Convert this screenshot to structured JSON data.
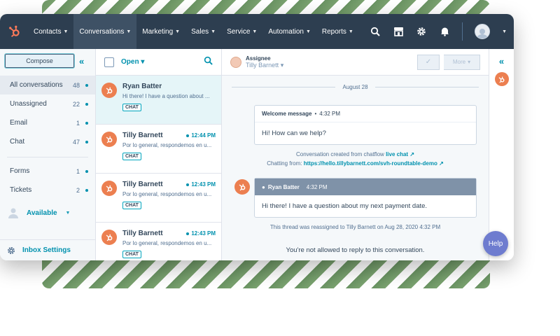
{
  "nav": {
    "items": [
      {
        "label": "Contacts"
      },
      {
        "label": "Conversations"
      },
      {
        "label": "Marketing"
      },
      {
        "label": "Sales"
      },
      {
        "label": "Service"
      },
      {
        "label": "Automation"
      },
      {
        "label": "Reports"
      }
    ],
    "active": "Conversations",
    "brand_color": "#ff7a59",
    "bg_color": "#2d3e50"
  },
  "sidebar": {
    "compose_label": "Compose",
    "items": [
      {
        "label": "All conversations",
        "count": "48"
      },
      {
        "label": "Unassigned",
        "count": "22"
      },
      {
        "label": "Email",
        "count": "1"
      },
      {
        "label": "Chat",
        "count": "47"
      }
    ],
    "items2": [
      {
        "label": "Forms",
        "count": "1"
      },
      {
        "label": "Tickets",
        "count": "2"
      }
    ],
    "status_label": "Available",
    "settings_label": "Inbox Settings"
  },
  "threads": {
    "filter_label": "Open",
    "items": [
      {
        "name": "Ryan Batter",
        "time": "",
        "preview": "Hi there! I have a question about ...",
        "badge": "CHAT"
      },
      {
        "name": "Tilly Barnett",
        "time": "12:44 PM",
        "preview": "Por lo general, respondemos en u...",
        "badge": "CHAT"
      },
      {
        "name": "Tilly Barnett",
        "time": "12:43 PM",
        "preview": "Por lo general, respondemos en u...",
        "badge": "CHAT"
      },
      {
        "name": "Tilly Barnett",
        "time": "12:43 PM",
        "preview": "Por lo general, respondemos en u...",
        "badge": "CHAT"
      }
    ]
  },
  "conversation": {
    "assignee_label": "Assignee",
    "assignee_name": "Tilly Barnett",
    "more_label": "More",
    "date": "August 28",
    "welcome": {
      "title": "Welcome message",
      "time": "4:32 PM",
      "text": "Hi! How can we help?"
    },
    "created_text": "Conversation created from chatflow",
    "created_link": "live chat",
    "chatting_from": "Chatting from:",
    "chatting_url": "https://hello.tillybarnett.com/svh-roundtable-demo",
    "customer_msg": {
      "name": "Ryan Batter",
      "time": "4:32 PM",
      "text": "Hi there! I have a question about my next payment date."
    },
    "reassigned_text": "This thread was reassigned to Tilly Barnett on Aug 28, 2020 4:32 PM",
    "not_allowed_text": "You're not allowed to reply to this conversation."
  },
  "help_label": "Help"
}
